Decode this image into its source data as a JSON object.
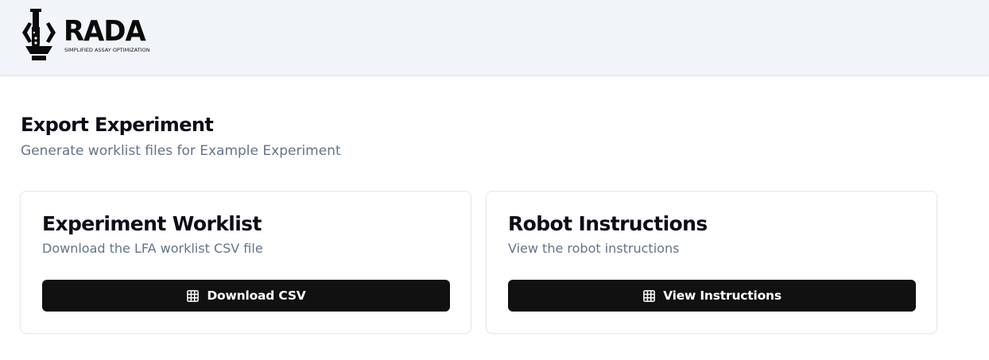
{
  "header": {
    "logo": {
      "icon": "flask-hexagon-icon",
      "wordmark": "RADA",
      "tagline": "SIMPLIFIED ASSAY OPTIMIZATION"
    }
  },
  "page": {
    "title": "Export Experiment",
    "subtitle": "Generate worklist files for Example Experiment"
  },
  "cards": [
    {
      "title": "Experiment Worklist",
      "description": "Download the LFA worklist CSV file",
      "button": {
        "label": "Download CSV",
        "icon": "table-icon"
      }
    },
    {
      "title": "Robot Instructions",
      "description": "View the robot instructions",
      "button": {
        "label": "View Instructions",
        "icon": "table-icon"
      }
    }
  ],
  "colors": {
    "header_bg": "#f1f4f8",
    "button_bg": "#111111",
    "muted_text": "#64748b",
    "card_border": "#e5e7eb"
  }
}
